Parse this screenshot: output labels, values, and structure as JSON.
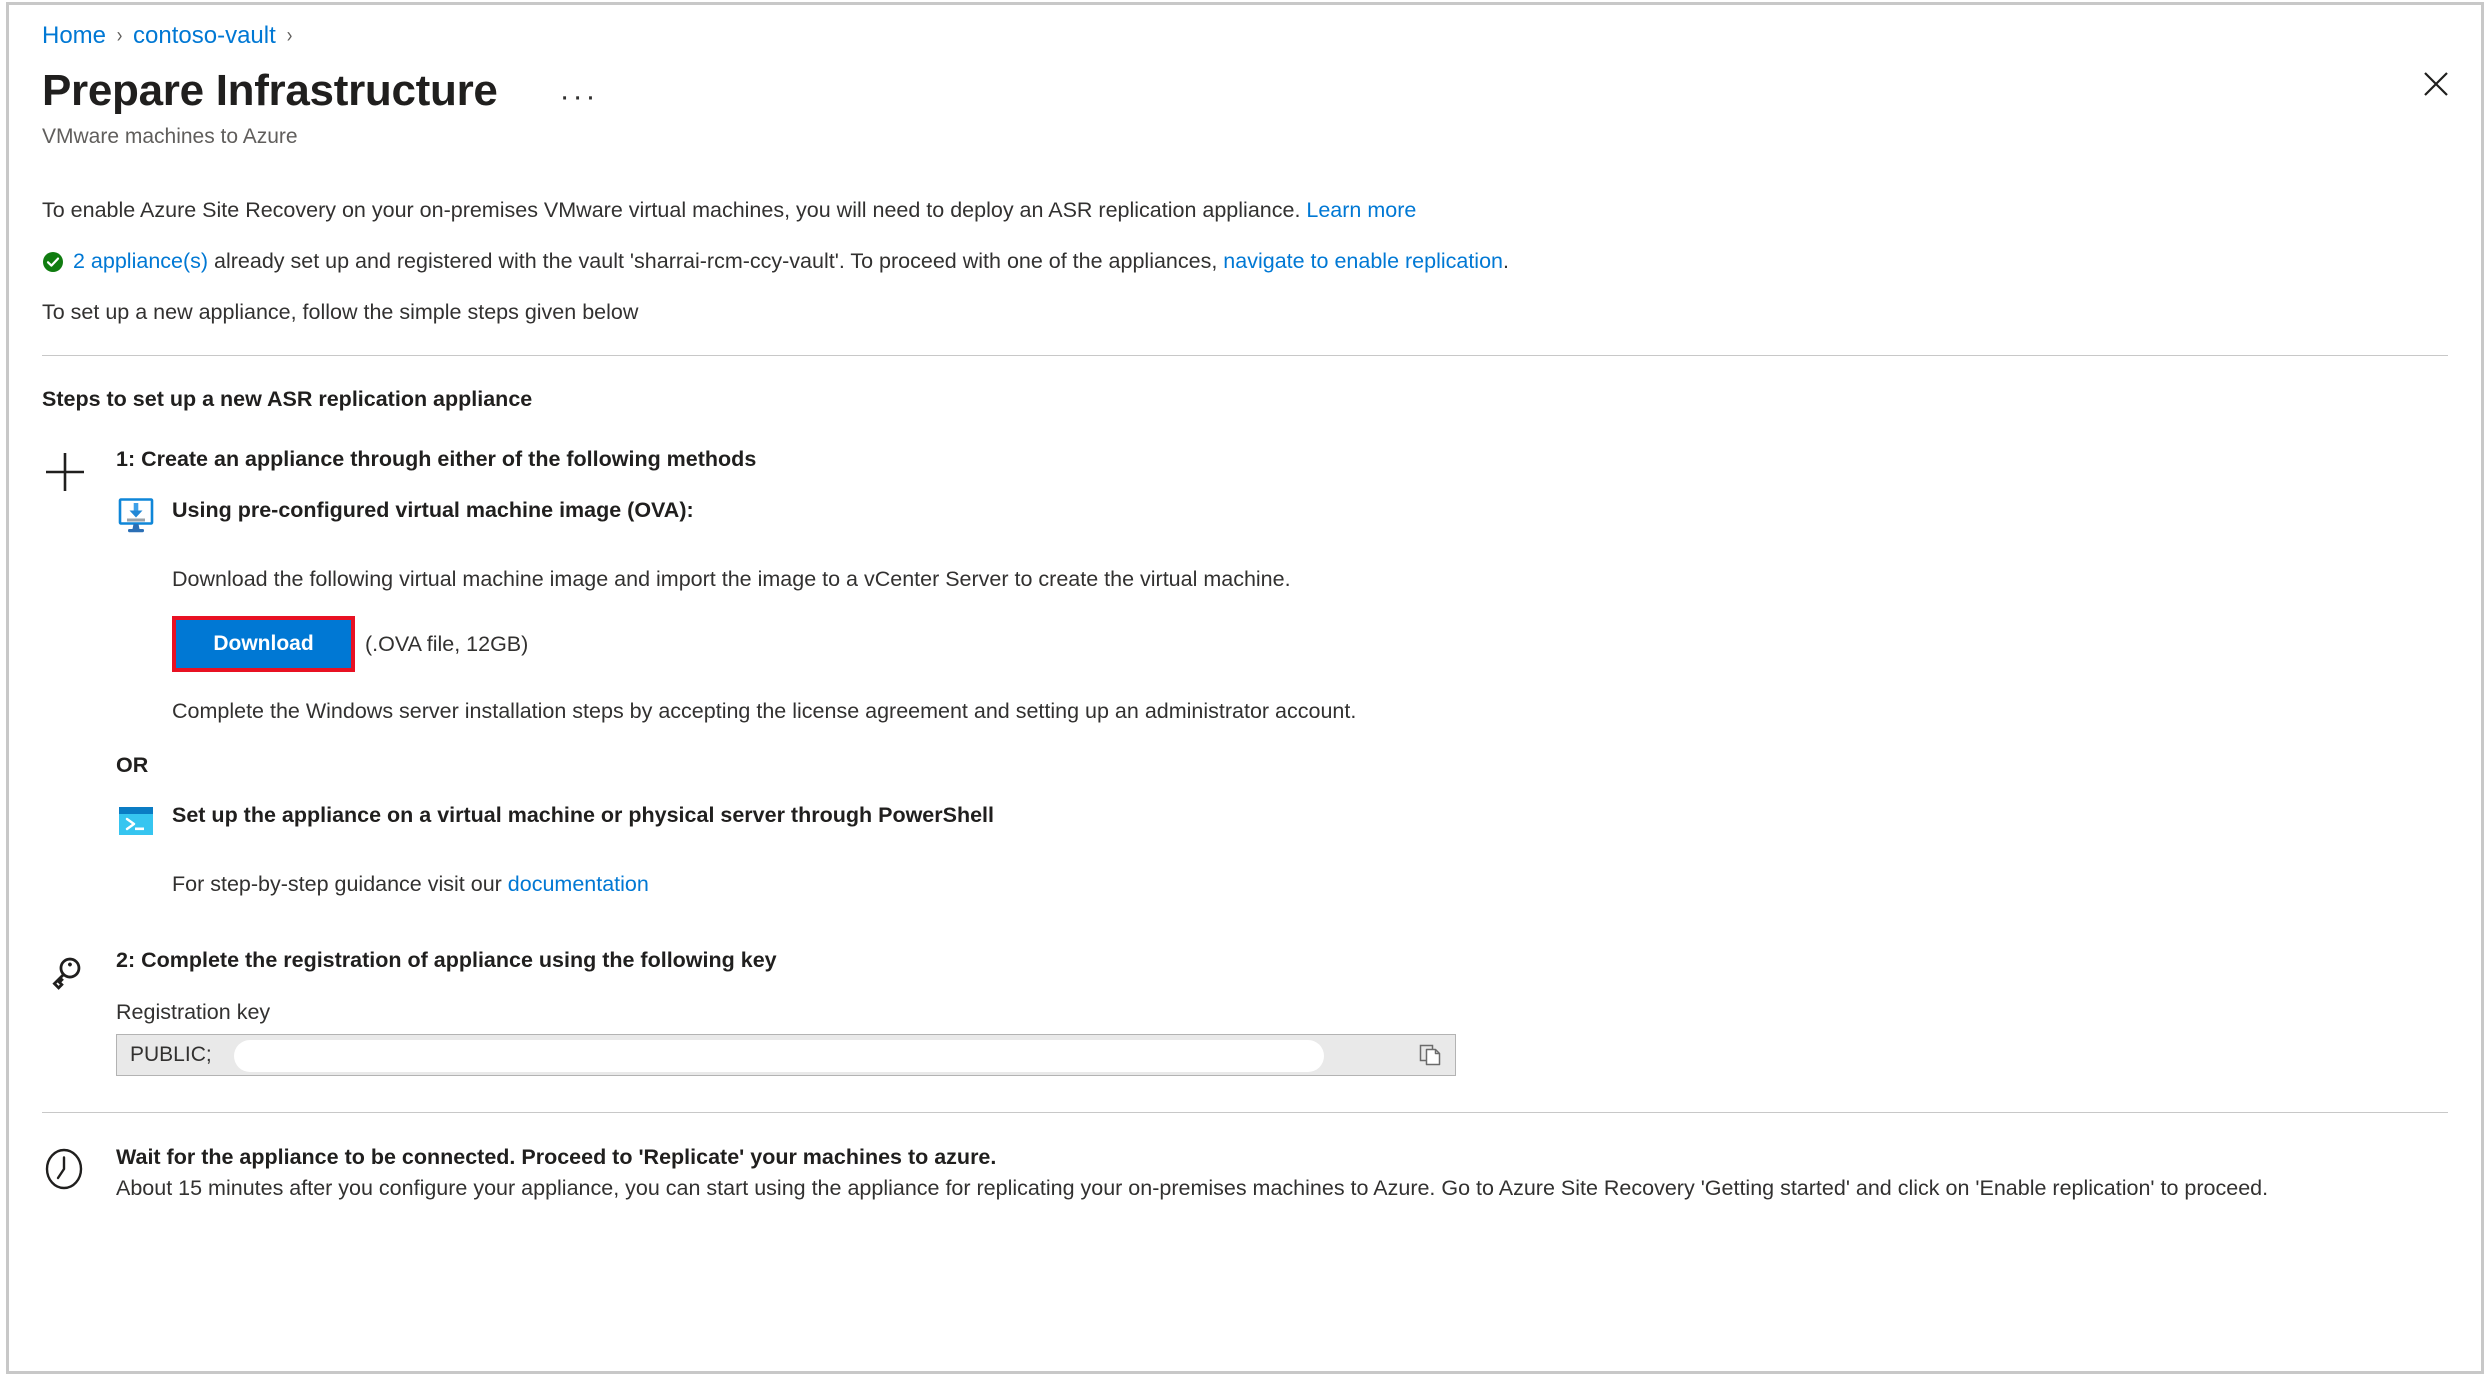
{
  "breadcrumb": {
    "items": [
      {
        "label": "Home"
      },
      {
        "label": "contoso-vault"
      }
    ],
    "separator": "›"
  },
  "header": {
    "title": "Prepare Infrastructure",
    "subtitle": "VMware machines to Azure",
    "more_label": "···",
    "close_label": "Close"
  },
  "intro": {
    "line1_before": "To enable Azure Site Recovery on your on-premises VMware virtual machines, you will need to deploy an ASR replication appliance. ",
    "line1_link": "Learn more",
    "line2_link1": "2 appliance(s)",
    "line2_mid": " already set up and registered with the vault 'sharrai-rcm-ccy-vault'. To proceed with one of the appliances, ",
    "line2_link2": "navigate to enable replication",
    "line2_end": ".",
    "line3": "To set up a new appliance, follow the simple steps given below"
  },
  "steps": {
    "heading": "Steps to set up a new ASR replication appliance",
    "step1": {
      "title": "1: Create an appliance through either of the following methods",
      "method_ova": {
        "title": "Using pre-configured virtual machine image (OVA):",
        "description": "Download the following virtual machine image and import the image to a vCenter Server to create the virtual machine.",
        "download_button": "Download",
        "download_note": "(.OVA file, 12GB)",
        "post_note": "Complete the Windows server installation steps by accepting the license agreement and setting up an administrator account."
      },
      "or_label": "OR",
      "method_powershell": {
        "title": "Set up the appliance on a virtual machine or physical server through PowerShell",
        "guidance_before": "For step-by-step guidance visit our ",
        "guidance_link": "documentation"
      }
    },
    "step2": {
      "title": "2: Complete the registration of appliance using the following key",
      "field_label": "Registration key",
      "field_value": "PUBLIC;",
      "copy_tooltip": "Copy to clipboard"
    }
  },
  "footer": {
    "title": "Wait for the appliance to be connected. Proceed to 'Replicate' your machines to azure.",
    "description": "About 15 minutes after you configure your appliance, you can start using the appliance for replicating your on-premises machines to Azure. Go to Azure Site Recovery 'Getting started' and click on 'Enable replication' to proceed."
  },
  "colors": {
    "accent": "#0078d4",
    "link": "#0078d4",
    "success": "#107c10",
    "highlight": "#e81123",
    "text": "#323130"
  }
}
